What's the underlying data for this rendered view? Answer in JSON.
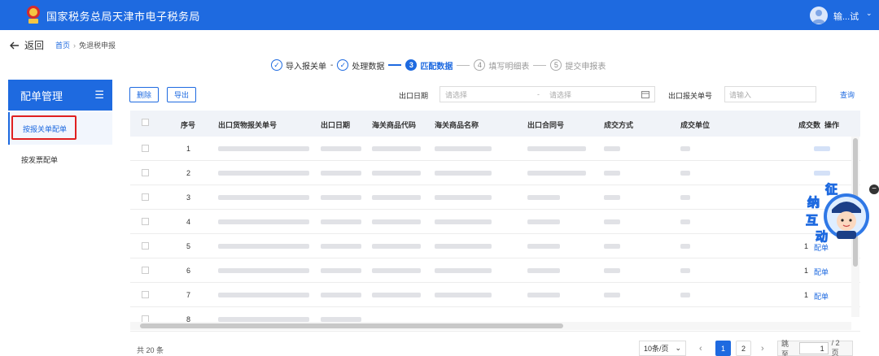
{
  "header": {
    "title": "国家税务总局天津市电子税务局",
    "user_name": "输...试",
    "user_caret": "⌄"
  },
  "nav": {
    "back_label": "返回",
    "breadcrumb_home": "首页",
    "breadcrumb_sep": "›",
    "breadcrumb_current": "免退税申报"
  },
  "steps": [
    {
      "marker": "✓",
      "label": "导入报关单"
    },
    {
      "marker": "✓",
      "label": "处理数据"
    },
    {
      "marker": "3",
      "label": "匹配数据"
    },
    {
      "marker": "4",
      "label": "填写明细表"
    },
    {
      "marker": "5",
      "label": "提交申报表"
    }
  ],
  "sidebar": {
    "title": "配单管理",
    "menu_icon": "☰",
    "items": [
      {
        "label": "按报关单配单"
      },
      {
        "label": "按发票配单"
      }
    ]
  },
  "toolbar": {
    "delete_label": "删除",
    "export_label": "导出"
  },
  "filters": {
    "export_date_label": "出口日期",
    "date_start_placeholder": "请选择",
    "date_dash": "-",
    "date_end_placeholder": "请选择",
    "declaration_label": "出口报关单号",
    "declaration_placeholder": "请输入",
    "query_label": "查询"
  },
  "table": {
    "columns": [
      "序号",
      "出口货物报关单号",
      "出口日期",
      "海关商品代码",
      "海关商品名称",
      "出口合同号",
      "成交方式",
      "成交单位",
      "成交数",
      "操作"
    ],
    "rows": [
      {
        "seq": "1",
        "op_num": "",
        "op": ""
      },
      {
        "seq": "2",
        "op_num": "",
        "op": ""
      },
      {
        "seq": "3",
        "op_num": "",
        "op": ""
      },
      {
        "seq": "4",
        "op_num": "",
        "op": ""
      },
      {
        "seq": "5",
        "op_num": "1",
        "op": "配单"
      },
      {
        "seq": "6",
        "op_num": "1",
        "op": "配单"
      },
      {
        "seq": "7",
        "op_num": "1",
        "op": "配单"
      },
      {
        "seq": "8",
        "op_num": "",
        "op": ""
      }
    ]
  },
  "mascot": {
    "text": [
      "征",
      "纳",
      "互",
      "动"
    ]
  },
  "float_button": "−",
  "pagination": {
    "total_text": "共 20 条",
    "page_size": "10条/页",
    "page_size_caret": "⌄",
    "prev": "‹",
    "pages": [
      "1",
      "2"
    ],
    "next": "›",
    "jump_label": "跳至",
    "jump_value": "1",
    "total_pages": "/ 2 页"
  },
  "colors": {
    "primary": "#1e6ae0",
    "highlight": "#e02020"
  }
}
